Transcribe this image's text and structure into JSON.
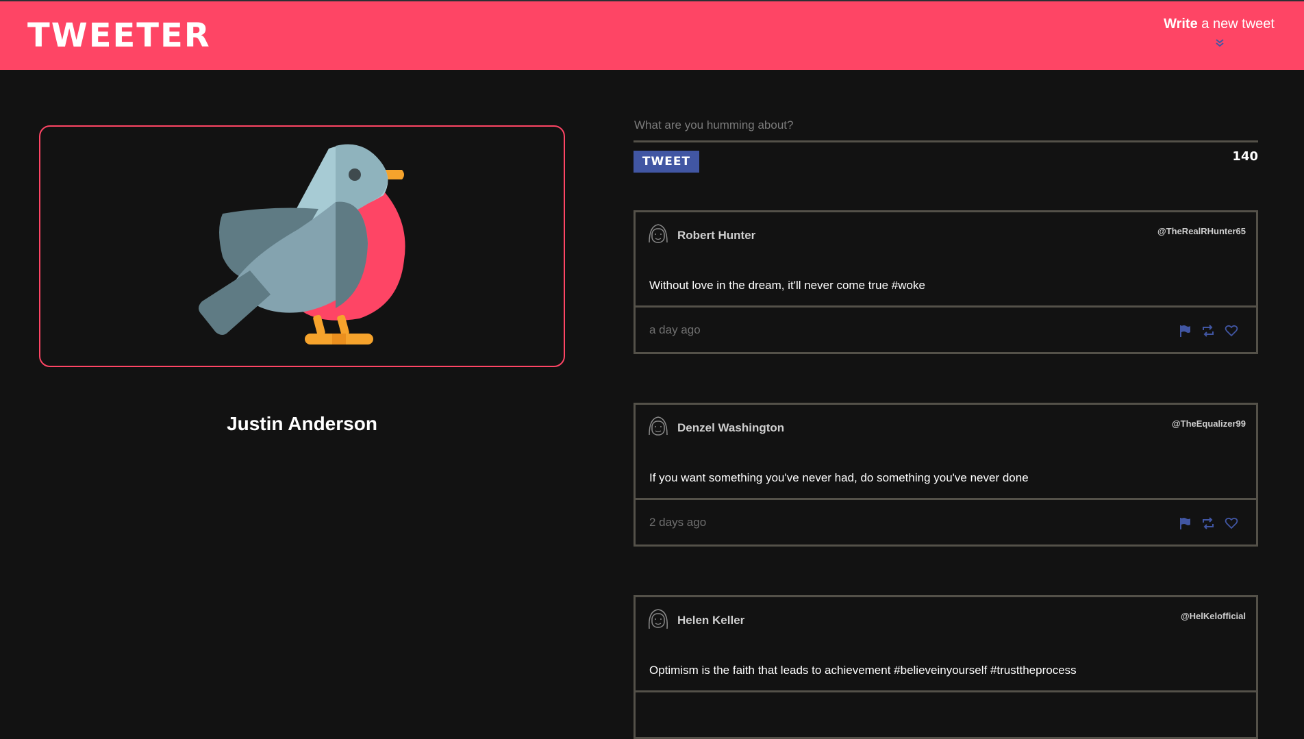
{
  "header": {
    "logo": "TWEETER",
    "write_bold": "Write",
    "write_rest": " a new tweet",
    "chevron_icon": "double-chevron-down-icon"
  },
  "profile": {
    "name": "Justin Anderson",
    "avatar_icon": "bird-icon"
  },
  "compose": {
    "placeholder": "What are you humming about?",
    "button_label": "TWEET",
    "counter": "140"
  },
  "colors": {
    "brand": "#fe4565",
    "accent": "#4156a3",
    "background": "#121212",
    "border": "#545149"
  },
  "tweets": [
    {
      "author": "Robert Hunter",
      "handle": "@TheRealRHunter65",
      "content": "Without love in the dream, it'll never come true #woke",
      "time": "a day ago"
    },
    {
      "author": "Denzel Washington",
      "handle": "@TheEqualizer99",
      "content": "If you want something you've never had, do something you've never done",
      "time": "2 days ago"
    },
    {
      "author": "Helen Keller",
      "handle": "@HelKelofficial",
      "content": "Optimism is the faith that leads to achievement #believeinyourself #trusttheprocess",
      "time": ""
    }
  ]
}
